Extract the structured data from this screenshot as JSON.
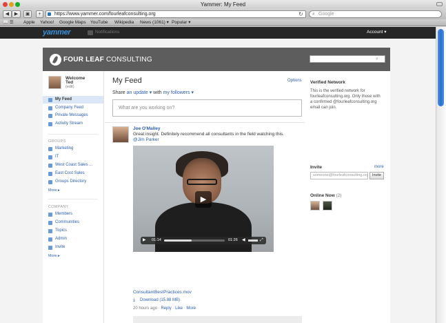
{
  "browser": {
    "window_title": "Yammer: My Feed",
    "url": "https://www.yammer.com/fourleafconsulting.org",
    "search_placeholder": "Google",
    "bookmarks": [
      "Apple",
      "Yahoo!",
      "Google Maps",
      "YouTube",
      "Wikipedia",
      "News (1061) ▾",
      "Popular ▾"
    ]
  },
  "yammer_bar": {
    "logo": "yammer",
    "notifications_label": "Notifications",
    "account_label": "Account ▾"
  },
  "company": {
    "name_bold": "FOUR LEAF",
    "name_rest": " CONSULTING"
  },
  "user": {
    "welcome": "Welcome",
    "name": "Ted",
    "edit": "(edit)"
  },
  "nav": {
    "feeds": [
      "My Feed",
      "Company Feed",
      "Private Messages",
      "Activity Stream"
    ],
    "groups_label": "GROUPS",
    "groups": [
      "Marketing",
      "IT",
      "West Coast Sales ...",
      "East Cost Sales",
      "Groups Directory"
    ],
    "groups_more": "More ▸",
    "company_label": "COMPANY",
    "company_items": [
      "Members",
      "Communities",
      "Topics",
      "Admin",
      "Invite"
    ],
    "company_more": "More ▸"
  },
  "main": {
    "title": "My Feed",
    "options": "Options",
    "share_prefix": "Share",
    "share_type": "an update ▾",
    "share_with": "with",
    "share_audience": "my followers ▾",
    "post_placeholder": "What are you working on?"
  },
  "post": {
    "author": "Joe O'Malley",
    "text": "Great insight. Definitely recommend all consultants in the field watching this.",
    "mention": "@Jim Parker",
    "video": {
      "elapsed": "01:14",
      "remaining": "01:26",
      "progress": 0.46
    },
    "filename": "ConsultantBestPractices.mov",
    "download": "Download (15.88 MB)",
    "time": "20 hours ago",
    "actions": [
      "Reply",
      "Like",
      "More"
    ]
  },
  "right": {
    "verified_heading": "Verified Network",
    "verified_text": "This is the verified network for fourleafconsulting.org. Only those with a confirmed @fourleafconsulting.org email can join.",
    "invite_heading": "Invite",
    "invite_more": "more",
    "invite_placeholder": "someone@fourleafconsulting.org",
    "invite_button": "Invite",
    "online_heading": "Online Now",
    "online_count": "(2)"
  },
  "colors": {
    "accent": "#2a5db0",
    "header_bg": "#5d5d5d",
    "yammer_bar_bg": "#262626",
    "active_nav_bg": "#dbe7f6"
  }
}
